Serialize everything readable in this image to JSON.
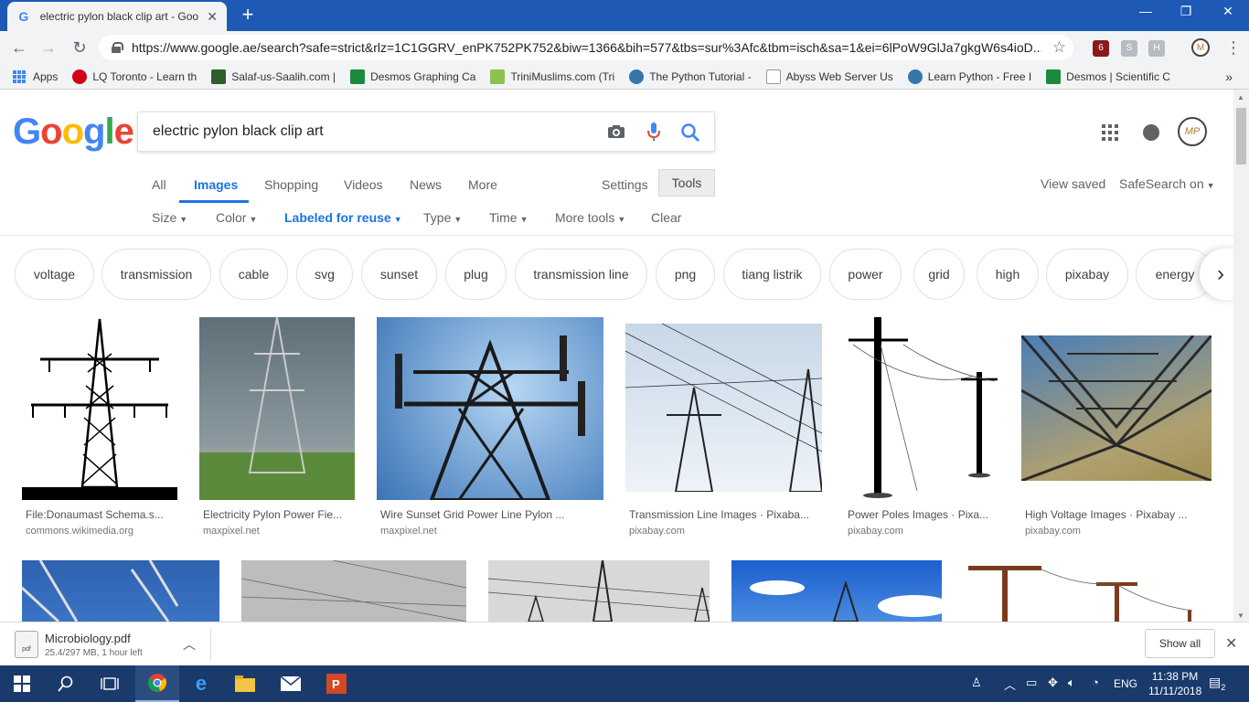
{
  "browser": {
    "tab_title": "electric pylon black clip art - Goo",
    "url": "https://www.google.ae/search?safe=strict&rlz=1C1GGRV_enPK752PK752&biw=1366&bih=577&tbs=sur%3Afc&tbm=isch&sa=1&ei=6lPoW9GlJa7gkgW6s4ioD...",
    "extension_badge": "6"
  },
  "bookmarks": [
    {
      "label": "Apps",
      "color": "#4285f4"
    },
    {
      "label": "LQ Toronto - Learn th",
      "color": "#d0021b"
    },
    {
      "label": "Salaf-us-Saalih.com |",
      "color": "#2e5e2a"
    },
    {
      "label": "Desmos Graphing Ca",
      "color": "#1b8a3c"
    },
    {
      "label": "TriniMuslims.com (Tri",
      "color": "#8bc34a"
    },
    {
      "label": "The Python Tutorial -",
      "color": "#3776ab"
    },
    {
      "label": "Abyss Web Server Us",
      "color": "#999999"
    },
    {
      "label": "Learn Python - Free I",
      "color": "#3776ab"
    },
    {
      "label": "Desmos | Scientific C",
      "color": "#1b8a3c"
    }
  ],
  "search": {
    "query": "electric pylon black clip art"
  },
  "logo": [
    "G",
    "o",
    "o",
    "g",
    "l",
    "e"
  ],
  "nav_tabs": [
    "All",
    "Images",
    "Shopping",
    "Videos",
    "News",
    "More"
  ],
  "settings_label": "Settings",
  "tools_label": "Tools",
  "view_saved": "View saved",
  "safesearch": "SafeSearch on",
  "filters": [
    "Size",
    "Color",
    "Labeled for reuse",
    "Type",
    "Time",
    "More tools",
    "Clear"
  ],
  "chips": [
    "voltage",
    "transmission",
    "cable",
    "svg",
    "sunset",
    "plug",
    "transmission line",
    "png",
    "tiang listrik",
    "power",
    "grid",
    "high",
    "pixabay",
    "energy"
  ],
  "results": [
    {
      "title": "File:Donaumast Schema.s...",
      "site": "commons.wikimedia.org"
    },
    {
      "title": "Electricity Pylon Power Fie...",
      "site": "maxpixel.net"
    },
    {
      "title": "Wire Sunset Grid Power Line Pylon ...",
      "site": "maxpixel.net"
    },
    {
      "title": "Transmission Line Images · Pixaba...",
      "site": "pixabay.com"
    },
    {
      "title": "Power Poles Images · Pixa...",
      "site": "pixabay.com"
    },
    {
      "title": "High Voltage Images · Pixabay ...",
      "site": "pixabay.com"
    }
  ],
  "download": {
    "file_name": "Microbiology.pdf",
    "status": "25.4/297 MB, 1 hour left",
    "icon_text": "pdf",
    "show_all": "Show all"
  },
  "taskbar": {
    "language": "ENG",
    "time": "11:38 PM",
    "date": "11/11/2018",
    "notifications": "2"
  },
  "colors": {
    "titlebar": "#1e59b6",
    "accent": "#1a73e8",
    "taskbar": "#193a6b"
  }
}
